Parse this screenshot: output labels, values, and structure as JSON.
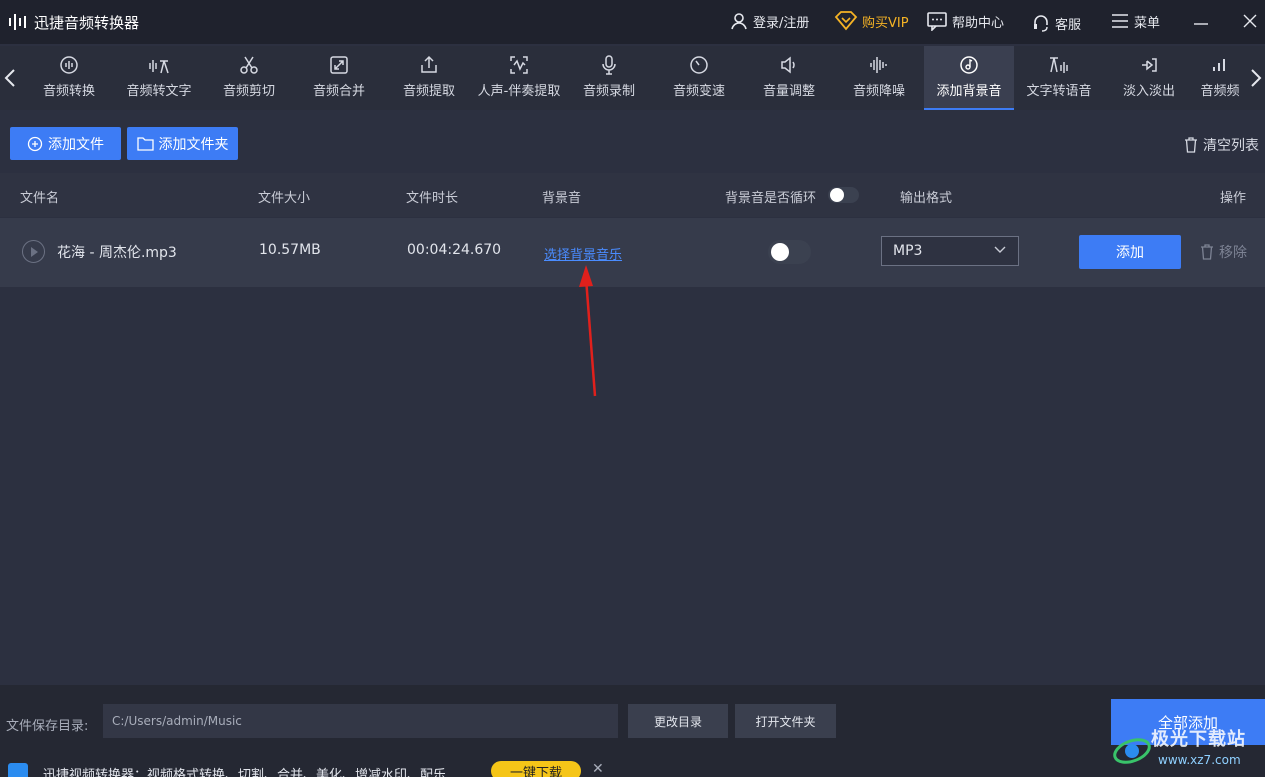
{
  "titlebar": {
    "app_title": "迅捷音频转换器",
    "login": "登录/注册",
    "vip": "购买VIP",
    "help": "帮助中心",
    "service": "客服",
    "menu": "菜单"
  },
  "nav": {
    "items": [
      {
        "label": "音频转换",
        "icon": "audio-convert-icon"
      },
      {
        "label": "音频转文字",
        "icon": "audio-to-text-icon"
      },
      {
        "label": "音频剪切",
        "icon": "scissors-icon"
      },
      {
        "label": "音频合并",
        "icon": "merge-icon"
      },
      {
        "label": "音频提取",
        "icon": "extract-icon"
      },
      {
        "label": "人声-伴奏提取",
        "icon": "vocal-icon"
      },
      {
        "label": "音频录制",
        "icon": "microphone-icon"
      },
      {
        "label": "音频变速",
        "icon": "speed-icon"
      },
      {
        "label": "音量调整",
        "icon": "volume-icon"
      },
      {
        "label": "音频降噪",
        "icon": "denoise-icon"
      },
      {
        "label": "添加背景音",
        "icon": "music-disc-icon",
        "active": true
      },
      {
        "label": "文字转语音",
        "icon": "text-to-speech-icon"
      },
      {
        "label": "淡入淡出",
        "icon": "fade-icon"
      },
      {
        "label": "音频频",
        "icon": "bars-icon"
      }
    ]
  },
  "toolbar": {
    "add_file": "添加文件",
    "add_folder": "添加文件夹",
    "clear_list": "清空列表"
  },
  "table": {
    "headers": {
      "name": "文件名",
      "size": "文件大小",
      "duration": "文件时长",
      "bg": "背景音",
      "loop": "背景音是否循环",
      "format": "输出格式",
      "action": "操作"
    },
    "rows": [
      {
        "name": "花海 - 周杰伦.mp3",
        "size": "10.57MB",
        "duration": "00:04:24.670",
        "bg_link": "选择背景音乐",
        "format": "MP3",
        "add": "添加",
        "remove": "移除"
      }
    ]
  },
  "footer": {
    "save_label": "文件保存目录:",
    "save_path": "C:/Users/admin/Music",
    "change_dir": "更改目录",
    "open_folder": "打开文件夹",
    "add_all": "全部添加",
    "ad_text": "迅捷视频转换器：视频格式转换、切割、合并、美化、增减水印、配乐",
    "ad_button": "一键下载",
    "ad_close": "✕"
  },
  "watermark": {
    "text": "极光下载站",
    "url": "www.xz7.com"
  },
  "colors": {
    "accent": "#3d7cf5",
    "link": "#4a8cff",
    "vip": "#f5b325",
    "annotation_arrow": "#e0201c"
  }
}
